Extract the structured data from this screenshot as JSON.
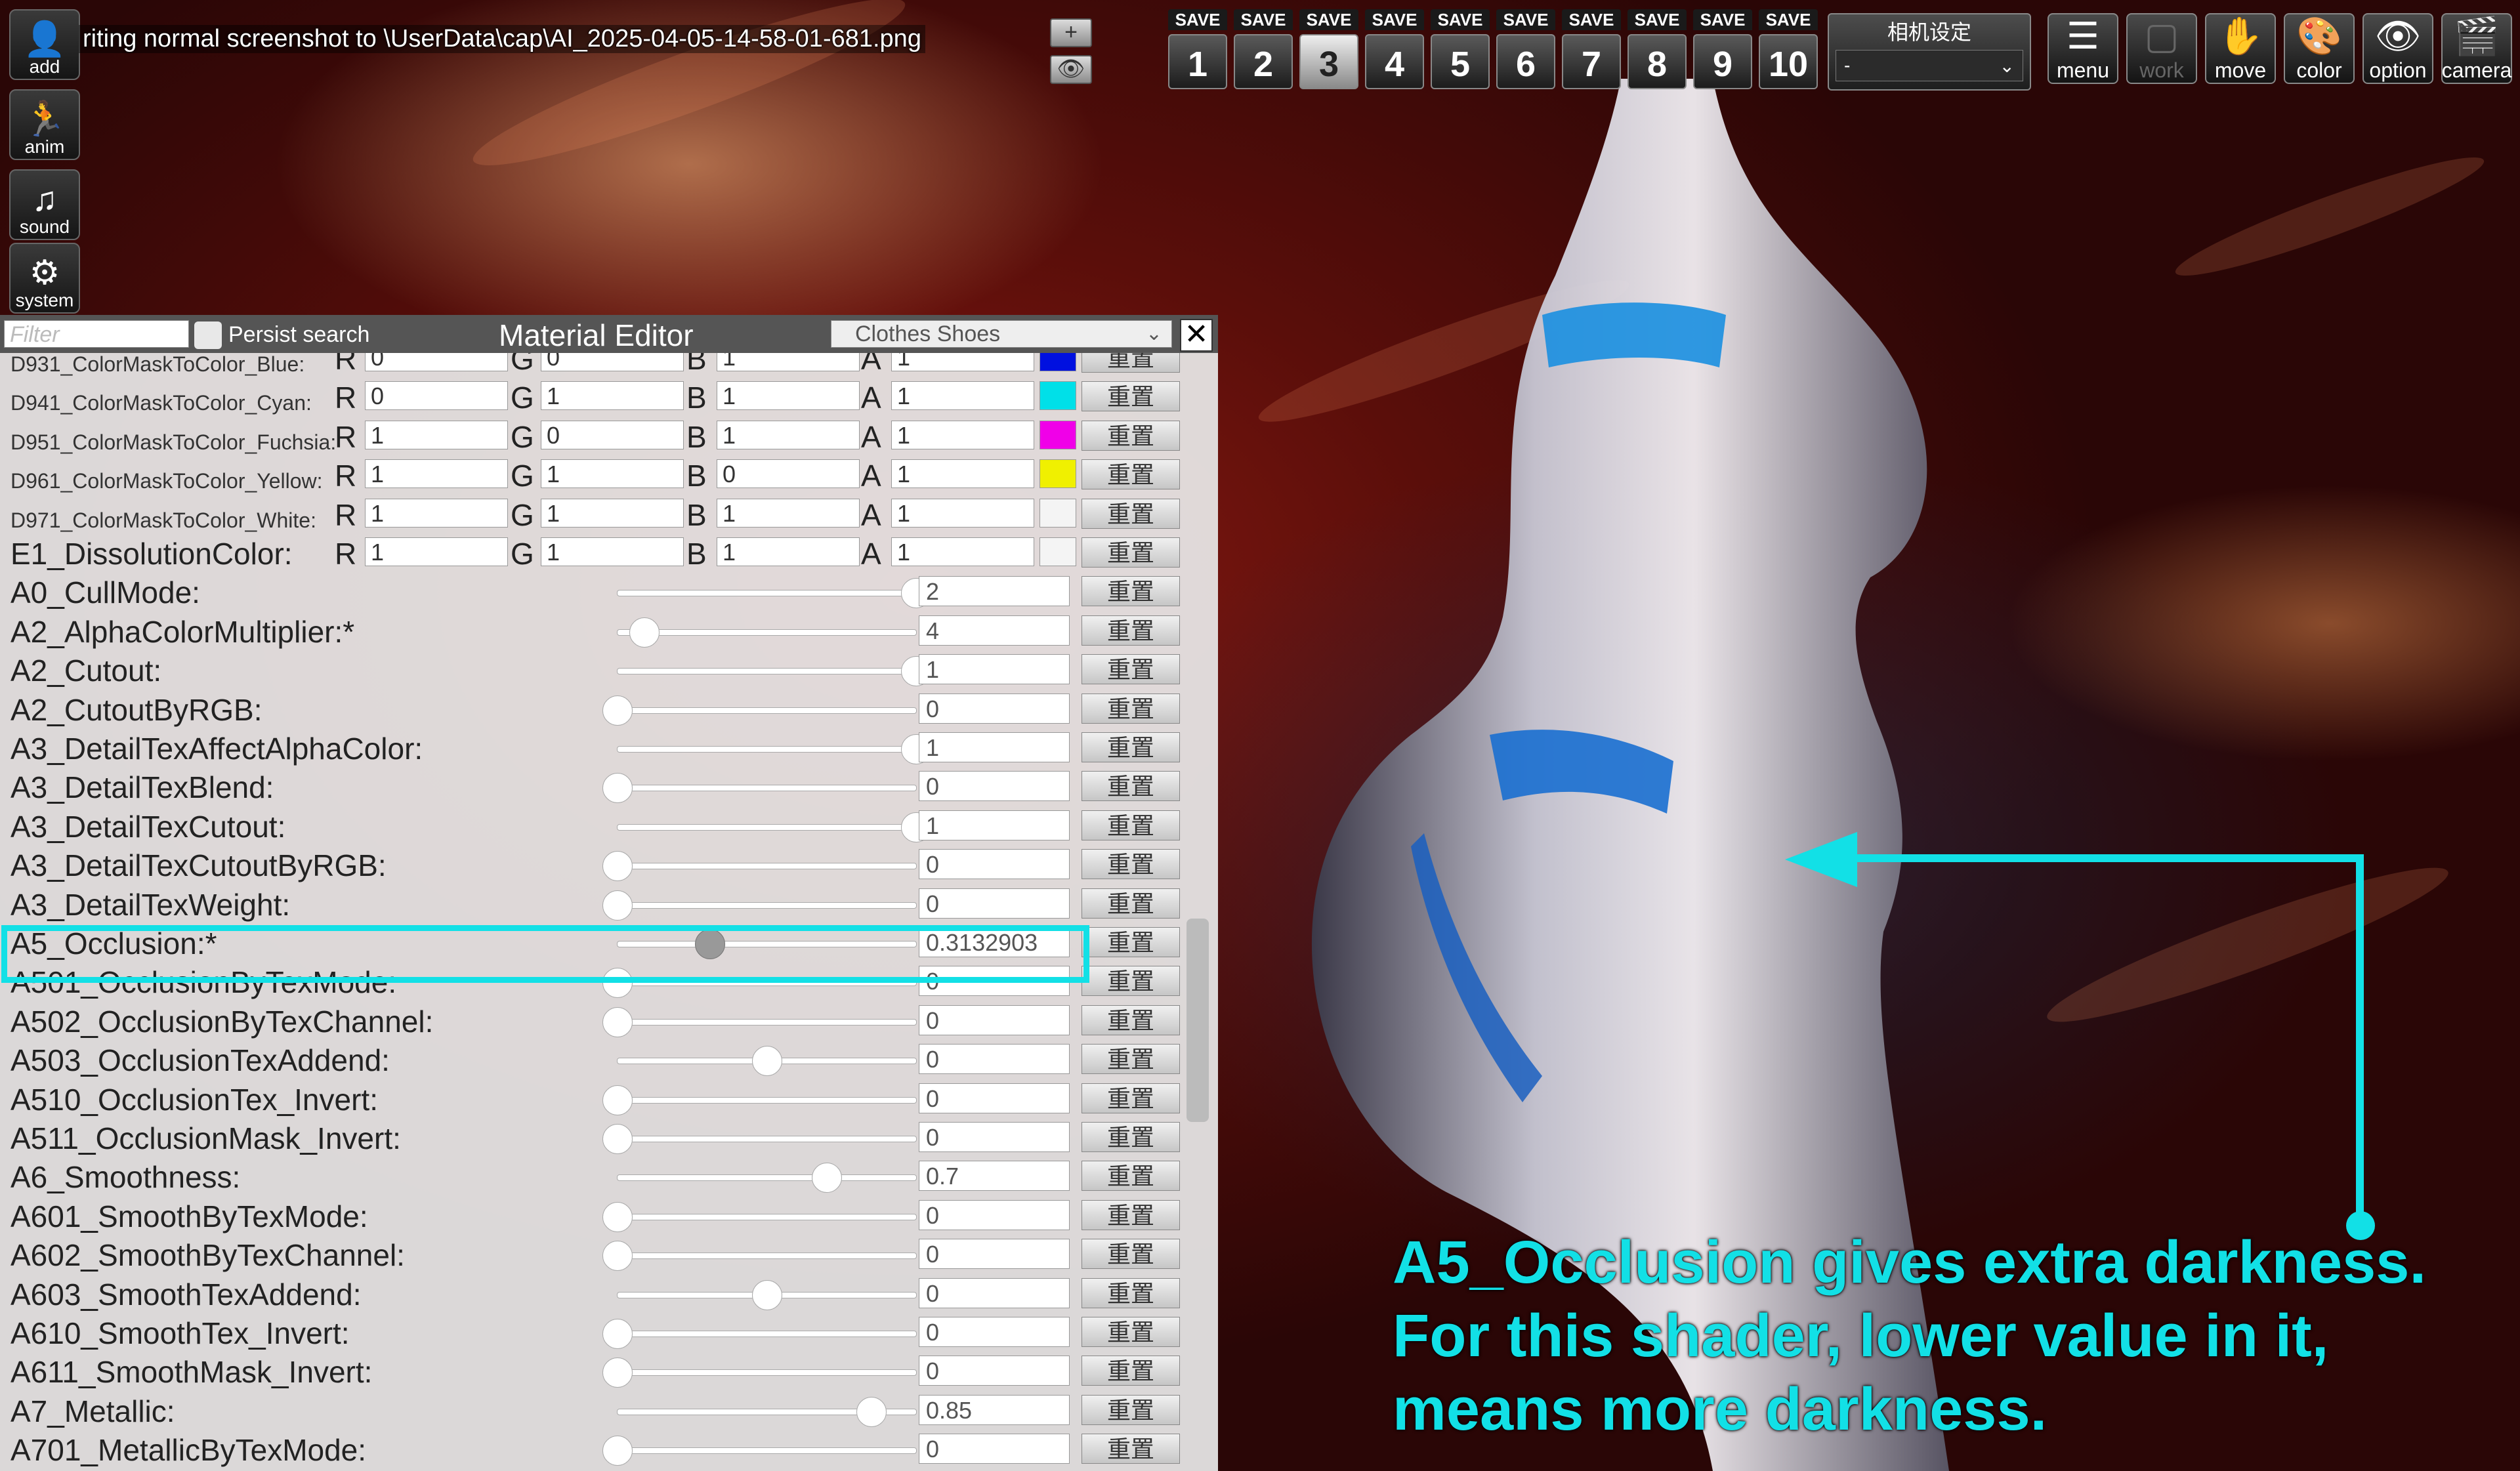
{
  "status": {
    "capture_message": "riting normal screenshot to \\UserData\\cap\\AI_2025-04-05-14-58-01-681.png"
  },
  "left_toolbar": [
    {
      "label": "add",
      "icon": "person-add-icon"
    },
    {
      "label": "anim",
      "icon": "running-figure-icon"
    },
    {
      "label": "sound",
      "icon": "music-note-icon"
    },
    {
      "label": "system",
      "icon": "gears-icon"
    }
  ],
  "small_buttons": {
    "plus": "+",
    "eye": "👁"
  },
  "save_slots": {
    "save_label": "SAVE",
    "slots": [
      "1",
      "2",
      "3",
      "4",
      "5",
      "6",
      "7",
      "8",
      "9",
      "10"
    ]
  },
  "camera_settings": {
    "title": "相机设定",
    "value": "-"
  },
  "top_tools": [
    {
      "label": "menu",
      "icon": "menu-list-icon"
    },
    {
      "label": "work",
      "icon": "work-icon"
    },
    {
      "label": "move",
      "icon": "hand-icon"
    },
    {
      "label": "color",
      "icon": "palette-icon"
    },
    {
      "label": "option",
      "icon": "eye-icon"
    },
    {
      "label": "camera",
      "icon": "clapperboard-icon"
    }
  ],
  "editor": {
    "filter_placeholder": "Filter",
    "persist_label": "Persist search",
    "title": "Material Editor",
    "category": "Clothes Shoes",
    "reset_label": "重置",
    "channels": [
      "R",
      "G",
      "B",
      "A"
    ],
    "color_rows": [
      {
        "name": "D931_ColorMaskToColor_Blue:",
        "values": [
          "0",
          "0",
          "1",
          "1"
        ],
        "swatch": "#0010e0"
      },
      {
        "name": "D941_ColorMaskToColor_Cyan:",
        "values": [
          "0",
          "1",
          "1",
          "1"
        ],
        "swatch": "#00e0e8"
      },
      {
        "name": "D951_ColorMaskToColor_Fuchsia:",
        "values": [
          "1",
          "0",
          "1",
          "1"
        ],
        "swatch": "#f000e8"
      },
      {
        "name": "D961_ColorMaskToColor_Yellow:",
        "values": [
          "1",
          "1",
          "0",
          "1"
        ],
        "swatch": "#f0f000"
      },
      {
        "name": "D971_ColorMaskToColor_White:",
        "values": [
          "1",
          "1",
          "1",
          "1"
        ],
        "swatch": "#f4f4f4"
      },
      {
        "name": "E1_DissolutionColor:",
        "values": [
          "1",
          "1",
          "1",
          "1"
        ],
        "swatch": "#f4f4f4"
      }
    ],
    "slider_rows": [
      {
        "name": "A0_CullMode:",
        "value": "2",
        "level": 1.0
      },
      {
        "name": "A2_AlphaColorMultiplier:*",
        "value": "4",
        "level": 0.09
      },
      {
        "name": "A2_Cutout:",
        "value": "1",
        "level": 1.0
      },
      {
        "name": "A2_CutoutByRGB:",
        "value": "0",
        "level": 0.0
      },
      {
        "name": "A3_DetailTexAffectAlphaColor:",
        "value": "1",
        "level": 1.0
      },
      {
        "name": "A3_DetailTexBlend:",
        "value": "0",
        "level": 0.0
      },
      {
        "name": "A3_DetailTexCutout:",
        "value": "1",
        "level": 1.0
      },
      {
        "name": "A3_DetailTexCutoutByRGB:",
        "value": "0",
        "level": 0.0
      },
      {
        "name": "A3_DetailTexWeight:",
        "value": "0",
        "level": 0.0
      },
      {
        "name": "A5_Occlusion:*",
        "value": "0.3132903",
        "level": 0.31
      },
      {
        "name": "A501_OcclusionByTexMode:",
        "value": "0",
        "level": 0.0
      },
      {
        "name": "A502_OcclusionByTexChannel:",
        "value": "0",
        "level": 0.0
      },
      {
        "name": "A503_OcclusionTexAddend:",
        "value": "0",
        "level": 0.5
      },
      {
        "name": "A510_OcclusionTex_Invert:",
        "value": "0",
        "level": 0.0
      },
      {
        "name": "A511_OcclusionMask_Invert:",
        "value": "0",
        "level": 0.0
      },
      {
        "name": "A6_Smoothness:",
        "value": "0.7",
        "level": 0.7
      },
      {
        "name": "A601_SmoothByTexMode:",
        "value": "0",
        "level": 0.0
      },
      {
        "name": "A602_SmoothByTexChannel:",
        "value": "0",
        "level": 0.0
      },
      {
        "name": "A603_SmoothTexAddend:",
        "value": "0",
        "level": 0.5
      },
      {
        "name": "A610_SmoothTex_Invert:",
        "value": "0",
        "level": 0.0
      },
      {
        "name": "A611_SmoothMask_Invert:",
        "value": "0",
        "level": 0.0
      },
      {
        "name": "A7_Metallic:",
        "value": "0.85",
        "level": 0.85
      },
      {
        "name": "A701_MetallicByTexMode:",
        "value": "0",
        "level": 0.0
      }
    ]
  },
  "annotation": {
    "lines": [
      "A5_Occlusion gives extra darkness.",
      "For this shader, lower value in it,",
      "means more darkness."
    ],
    "color": "#12e0e6"
  }
}
